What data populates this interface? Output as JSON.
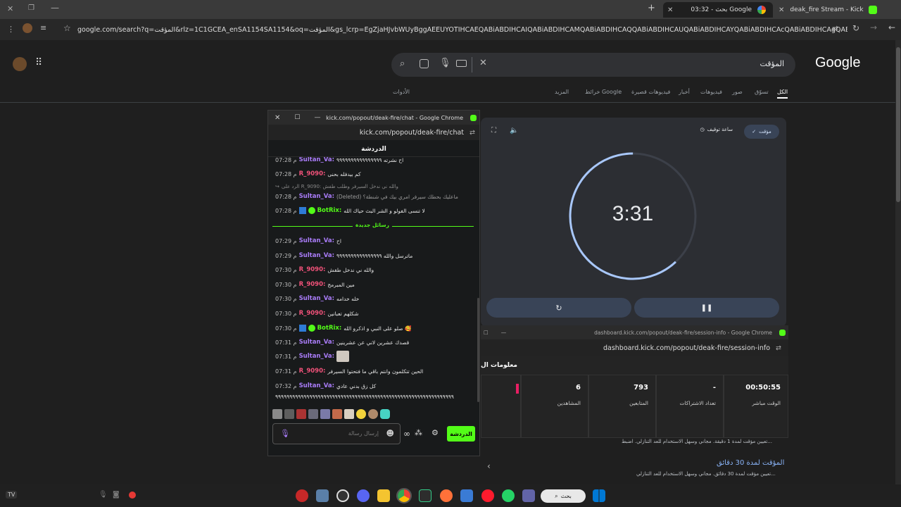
{
  "browser": {
    "tabs": [
      {
        "label": "deak_fire Stream - Kick Dashbo"
      },
      {
        "label": "03:32 - بحث Google"
      }
    ],
    "url": "google.com/search?q=المؤقت&rlz=1C1GCEA_enSA1154SA1154&oq=المؤقت&gs_lcrp=EgZjaHJvbWUyBggAEEUYOTIHCAEQABiABDIHCAIQABiABDIHCAMQABiABDIHCAQQABiABDIHCAUQABiABDIHCAYQABiABDIHCAcQABiABDIHCAgQABiABDIHCAkQABiABN..."
  },
  "google": {
    "logo": "Google",
    "query": "المؤقت",
    "tabs": [
      "الكل",
      "تسوّق",
      "صور",
      "فيديوهات",
      "أخبار",
      "فيديوهات قصيرة",
      "خرائط Google",
      "المزيد",
      "الأدوات"
    ],
    "timer": {
      "mode_timer": "مؤقت",
      "mode_stopwatch": "ساعة توقيف",
      "time": "3:31",
      "progress_fraction": 0.62
    },
    "results": [
      {
        "snippet": "تعيين مؤقت لمدة 1 دقيقة. مجاني وسهل الاستخدام للعد التنازلي. اضبط..."
      },
      {
        "title": "المؤقت لمدة 30 دقائق",
        "snippet": "تعيين مؤقت لمدة 30 دقائق. مجاني وسهل الاستخدام للعد التنازلي..."
      }
    ]
  },
  "session_window": {
    "title": "dashboard.kick.com/popout/deak-fire/session-info - Google Chrome",
    "url": "dashboard.kick.com/popout/deak-fire/session-info",
    "header": "معلومات ال",
    "stats": [
      {
        "value": "00:50:55",
        "label": "الوقت مباشر"
      },
      {
        "value": "-",
        "label": "تعداد الاشتراكات"
      },
      {
        "value": "793",
        "label": "المتابعين"
      },
      {
        "value": "6",
        "label": "المشاهدين"
      }
    ]
  },
  "chat_window": {
    "title": "kick.com/popout/deak-fire/chat - Google Chrome",
    "url": "kick.com/popout/deak-fire/chat",
    "header": "الدردشة",
    "new_messages_label": "رسائل جديدة",
    "input_placeholder": "إرسال رسالة",
    "send_label": "الدردشة",
    "messages": [
      {
        "time": "07:28 م",
        "user": "Sultan_Va:",
        "color": "#a97cf8",
        "text": "اح نشرته ٩٩٩٩٩٩٩٩٩٩٩٩٩٩٩٩"
      },
      {
        "time": "07:28 م",
        "user": "R_9090:",
        "color": "#f2527a",
        "text": "كم بيدفله بحنى"
      },
      {
        "time": "07:28 م",
        "user": "Sultan_Va:",
        "color": "#a97cf8",
        "text": "(Deleted) ماعليك بحطك سيرفر امري بيك في شنطة؟",
        "reply": "الرد على R_9090: والله ني ندخل السيرفر وطلب طفش"
      },
      {
        "time": "07:28 م",
        "user": "BotRix:",
        "color": "#53fc18",
        "text": "لا تنسى الفولو و الشر البث حياك الله"
      },
      {
        "time": "07:29 م",
        "user": "Sultan_Va:",
        "color": "#a97cf8",
        "text": "اح"
      },
      {
        "time": "07:29 م",
        "user": "Sultan_Va:",
        "color": "#a97cf8",
        "text": "ماترسل والله ٩٩٩٩٩٩٩٩٩٩٩٩٩٩٩٩"
      },
      {
        "time": "07:30 م",
        "user": "R_9090:",
        "color": "#f2527a",
        "text": "والله ني ندخل طفش"
      },
      {
        "time": "07:30 م",
        "user": "R_9090:",
        "color": "#f2527a",
        "text": "مين المبرمج"
      },
      {
        "time": "07:30 م",
        "user": "Sultan_Va:",
        "color": "#a97cf8",
        "text": "خله خدامه"
      },
      {
        "time": "07:30 م",
        "user": "R_9090:",
        "color": "#f2527a",
        "text": "شكلهم تعبانين"
      },
      {
        "time": "07:30 م",
        "user": "BotRix:",
        "color": "#53fc18",
        "text": "صلو على النبي و اذكرو الله 🥰"
      },
      {
        "time": "07:31 م",
        "user": "Sultan_Va:",
        "color": "#a97cf8",
        "text": "قصدك عشرين لاني عن عشرينين"
      },
      {
        "time": "07:31 م",
        "user": "Sultan_Va:",
        "color": "#a97cf8",
        "text": ""
      },
      {
        "time": "07:31 م",
        "user": "R_9090:",
        "color": "#f2527a",
        "text": "الحين تتكلمون وانتم باقي ما فتحتوا السيرفر"
      },
      {
        "time": "07:32 م",
        "user": "Sultan_Va:",
        "color": "#a97cf8",
        "text": "كل زق بدني عادي"
      },
      {
        "time": "",
        "user": "",
        "color": "#e6e6e6",
        "text": "٩٩٩٩٩٩٩٩٩٩٩٩٩٩٩٩٩٩٩٩٩٩٩٩٩٩٩٩٩٩٩٩٩٩٩٩٩٩٩٩٩٩٩٩٩٩٩٩٩٩٩٩٩٩٩٩٩٩٩٩٩٩٩"
      }
    ]
  },
  "taskbar": {
    "search_label": "بحث",
    "tray_text": "TV"
  },
  "colors": {
    "kick_green": "#53fc18",
    "timer_arc": "#a8c7fa",
    "google_blue": "#8ab4f8"
  }
}
